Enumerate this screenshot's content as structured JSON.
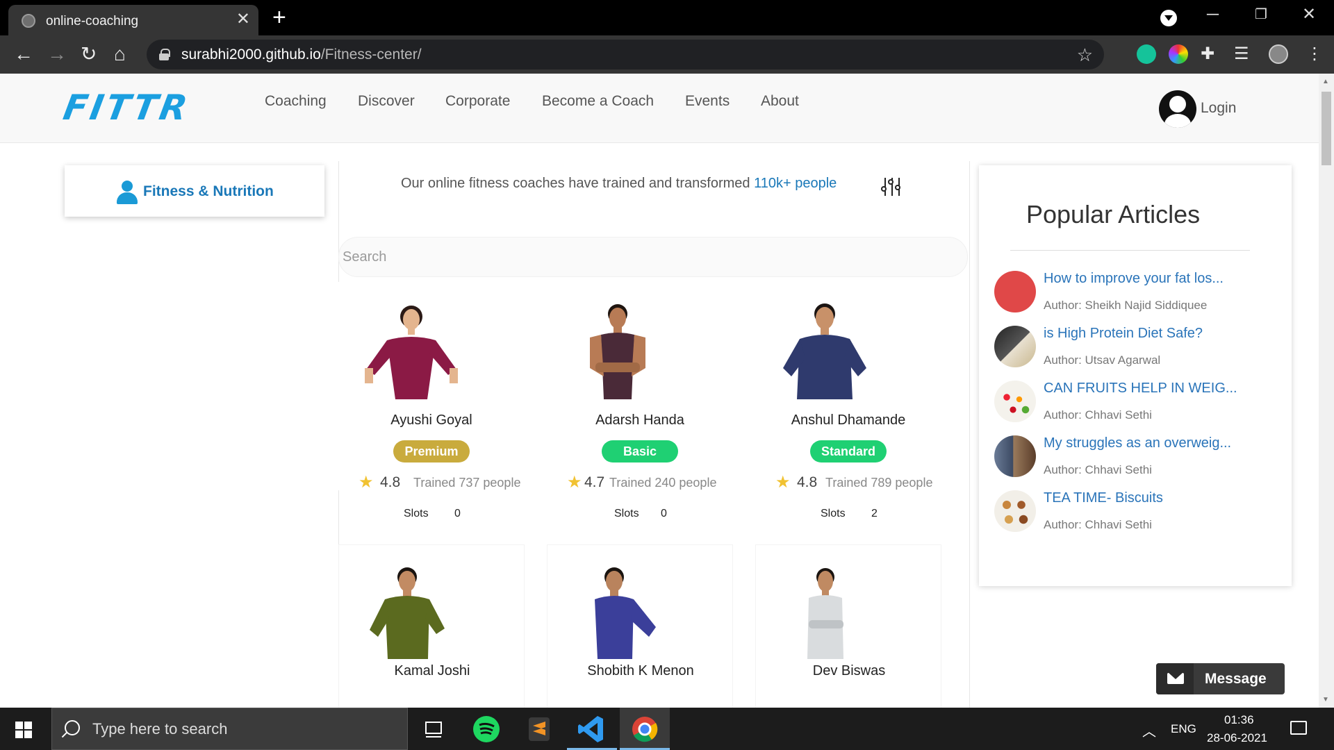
{
  "browser": {
    "tab_title": "online-coaching",
    "url_host": "surabhi2000.github.io",
    "url_path": "/Fitness-center/"
  },
  "header": {
    "logo": "FITTR",
    "nav": [
      "Coaching",
      "Discover",
      "Corporate",
      "Become a Coach",
      "Events",
      "About"
    ],
    "login": "Login"
  },
  "category": {
    "label": "Fitness & Nutrition"
  },
  "intro": {
    "text": "Our online fitness coaches have trained and transformed ",
    "highlight": "110k+ people"
  },
  "search": {
    "placeholder": "Search"
  },
  "coaches": [
    {
      "name": "Ayushi Goyal",
      "plan": "Premium",
      "rating": "4.8",
      "trained": "Trained 737 people",
      "slots_label": "Slots",
      "slots": "0"
    },
    {
      "name": "Adarsh Handa",
      "plan": "Basic",
      "rating": "4.7",
      "trained": "Trained 240 people",
      "slots_label": "Slots",
      "slots": "0"
    },
    {
      "name": "Anshul Dhamande",
      "plan": "Standard",
      "rating": "4.8",
      "trained": "Trained 789 people",
      "slots_label": "Slots",
      "slots": "2"
    },
    {
      "name": "Kamal Joshi"
    },
    {
      "name": "Shobith K Menon"
    },
    {
      "name": "Dev Biswas"
    }
  ],
  "plan_colors": {
    "Premium": "#c9ab3d",
    "Basic": "#1fd073",
    "Standard": "#1fd073"
  },
  "articles": {
    "title": "Popular Articles",
    "items": [
      {
        "title": "How to improve your fat los...",
        "author": "Author: Sheikh Najid Siddiquee"
      },
      {
        "title": "is High Protein Diet Safe?",
        "author": "Author: Utsav Agarwal"
      },
      {
        "title": "CAN FRUITS HELP IN WEIG...",
        "author": "Author: Chhavi Sethi"
      },
      {
        "title": "My struggles as an overweig...",
        "author": "Author: Chhavi Sethi"
      },
      {
        "title": "TEA TIME- Biscuits",
        "author": "Author: Chhavi Sethi"
      }
    ]
  },
  "message_button": "Message",
  "taskbar": {
    "search_placeholder": "Type here to search",
    "language": "ENG",
    "time": "01:36",
    "date": "28-06-2021"
  }
}
